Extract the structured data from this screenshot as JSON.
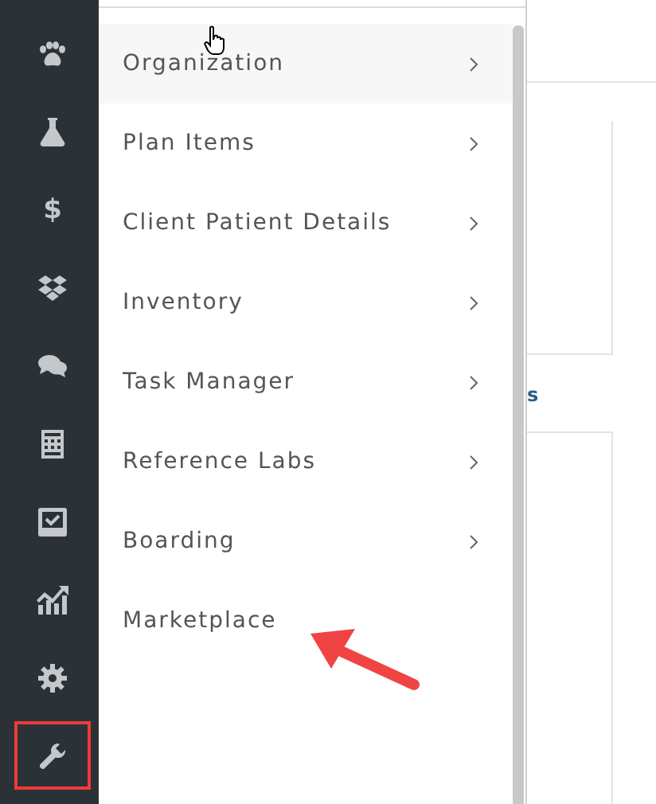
{
  "sidebar": {
    "items": [
      {
        "kind": "paw",
        "highlighted": false
      },
      {
        "kind": "flask",
        "highlighted": false
      },
      {
        "kind": "dollar",
        "glyph": "$",
        "highlighted": false
      },
      {
        "kind": "boxes",
        "highlighted": false
      },
      {
        "kind": "chat",
        "highlighted": false
      },
      {
        "kind": "calculator",
        "highlighted": false
      },
      {
        "kind": "inbox",
        "highlighted": false
      },
      {
        "kind": "chart",
        "highlighted": false
      },
      {
        "kind": "gear",
        "highlighted": false
      },
      {
        "kind": "wrench",
        "highlighted": true
      }
    ]
  },
  "menu": {
    "items": [
      {
        "label": "Organization",
        "hovered": true,
        "submenu": true
      },
      {
        "label": "Plan Items",
        "hovered": false,
        "submenu": true
      },
      {
        "label": "Client Patient Details",
        "hovered": false,
        "submenu": true
      },
      {
        "label": "Inventory",
        "hovered": false,
        "submenu": true
      },
      {
        "label": "Task Manager",
        "hovered": false,
        "submenu": true
      },
      {
        "label": "Reference Labs",
        "hovered": false,
        "submenu": true
      },
      {
        "label": "Boarding",
        "hovered": false,
        "submenu": true
      },
      {
        "label": "Marketplace",
        "hovered": false,
        "submenu": false
      }
    ]
  },
  "content": {
    "heading_fragment": "s"
  }
}
